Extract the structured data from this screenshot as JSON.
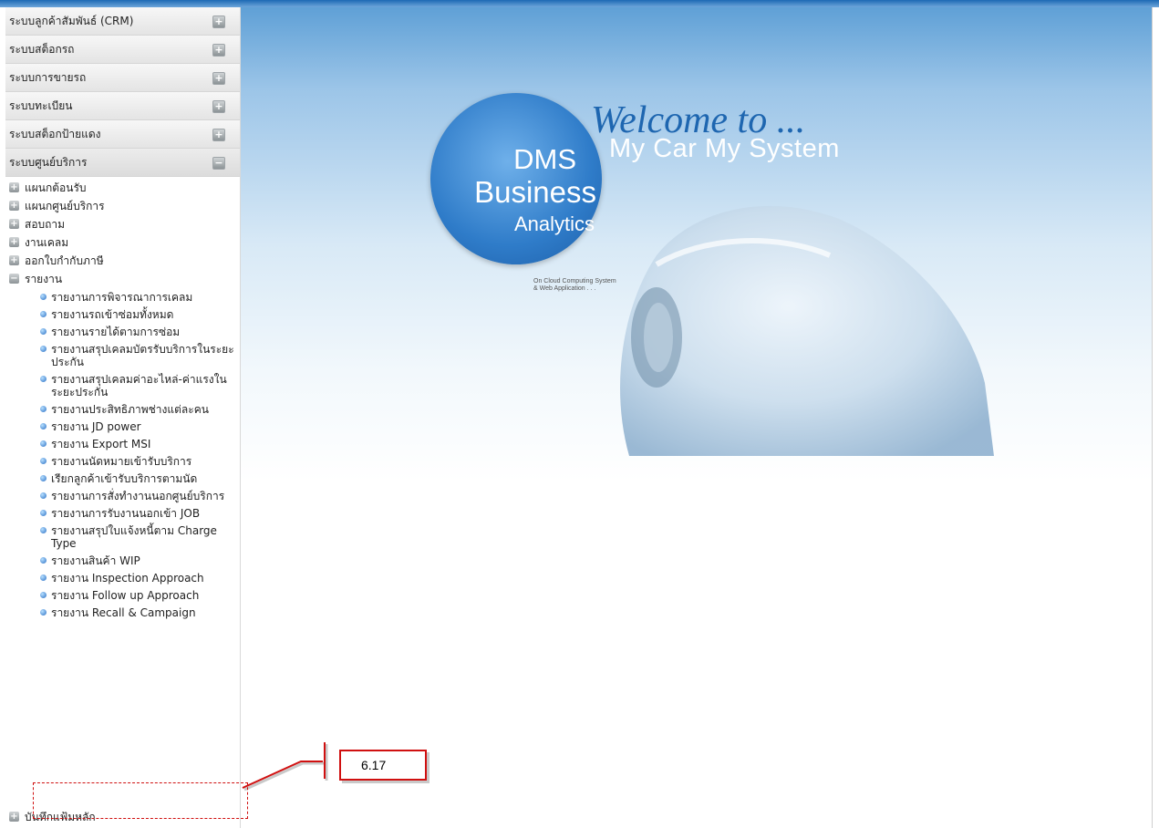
{
  "sidebar": {
    "sections": [
      {
        "label": "ระบบลูกค้าสัมพันธ์ (CRM)",
        "toggle": "+"
      },
      {
        "label": "ระบบสต็อกรถ",
        "toggle": "+"
      },
      {
        "label": "ระบบการขายรถ",
        "toggle": "+"
      },
      {
        "label": "ระบบทะเบียน",
        "toggle": "+"
      },
      {
        "label": "ระบบสต็อกป้ายแดง",
        "toggle": "+"
      },
      {
        "label": "ระบบศูนย์บริการ",
        "toggle": "−"
      }
    ],
    "service_items": [
      {
        "label": "แผนกต้อนรับ",
        "toggle": "+"
      },
      {
        "label": "แผนกศูนย์บริการ",
        "toggle": "+"
      },
      {
        "label": "สอบถาม",
        "toggle": "+"
      },
      {
        "label": "งานเคลม",
        "toggle": "+"
      },
      {
        "label": "ออกใบกำกับภาษี",
        "toggle": "+"
      },
      {
        "label": "รายงาน",
        "toggle": "−"
      }
    ],
    "reports": [
      "รายงานการพิจารณาการเคลม",
      "รายงานรถเข้าซ่อมทั้งหมด",
      "รายงานรายได้ตามการซ่อม",
      "รายงานสรุปเคลมบัตรรับบริการในระยะประกัน",
      "รายงานสรุปเคลมค่าอะไหล่-ค่าแรงในระยะประกัน",
      "รายงานประสิทธิภาพช่างแต่ละคน",
      "รายงาน JD power",
      "รายงาน Export MSI",
      "รายงานนัดหมายเข้ารับบริการ",
      "เรียกลูกค้าเข้ารับบริการตามนัด",
      "รายงานการสั่งทำงานนอกศูนย์บริการ",
      "รายงานการรับงานนอกเข้า JOB",
      "รายงานสรุปใบแจ้งหนี้ตาม Charge Type",
      "รายงานสินค้า WIP",
      "รายงาน Inspection Approach",
      "รายงาน Follow up Approach",
      "รายงาน Recall & Campaign"
    ],
    "last_item": {
      "label": "บันทึกแฟ้มหลัก",
      "toggle": "+"
    }
  },
  "banner": {
    "welcome": "Welcome to ...",
    "tagline_main": "My Car  My System",
    "logo_line1": "DMS",
    "logo_line2": "Business",
    "logo_line3": "Analytics",
    "logo_sub1": "On Cloud Computing System",
    "logo_sub2": "& Web Application . . ."
  },
  "annotation": {
    "label": "6.17",
    "color": "#d01010"
  },
  "colors": {
    "accent": "#1d69b4",
    "logo": "#2f7cc9",
    "annotation": "#d01010"
  }
}
